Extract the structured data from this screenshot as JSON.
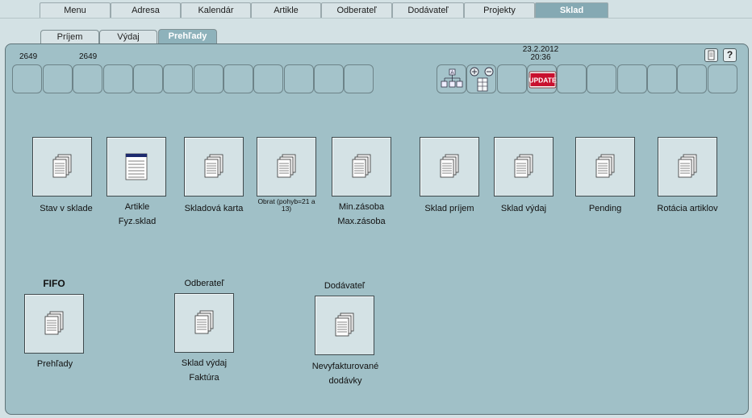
{
  "top_tabs": [
    {
      "label": "Menu"
    },
    {
      "label": "Adresa"
    },
    {
      "label": "Kalendár"
    },
    {
      "label": "Artikle"
    },
    {
      "label": "Odberateľ"
    },
    {
      "label": "Dodávateľ"
    },
    {
      "label": "Projekty"
    },
    {
      "label": "Sklad"
    }
  ],
  "sub_tabs": [
    {
      "label": "Príjem"
    },
    {
      "label": "Výdaj"
    },
    {
      "label": "Prehľady"
    }
  ],
  "header": {
    "code_left": "2649",
    "code_right": "2649",
    "date": "23.2.2012",
    "time": "20:36",
    "update_label": "UPDATE",
    "help_label": "?"
  },
  "tiles": [
    {
      "line1": "Stav v sklade",
      "line2": ""
    },
    {
      "line1": "Artikle",
      "line2": "Fyz.sklad"
    },
    {
      "line1": "Skladová karta",
      "line2": ""
    },
    {
      "line1": "Obrat (pohyb=21 a",
      "line2": "13)"
    },
    {
      "line1": "Min.zásoba",
      "line2": "Max.zásoba"
    },
    {
      "line1": "Sklad príjem",
      "line2": ""
    },
    {
      "line1": "Sklad výdaj",
      "line2": ""
    },
    {
      "line1": "Pending",
      "line2": ""
    },
    {
      "line1": "Rotácia artiklov",
      "line2": ""
    }
  ],
  "groups": [
    {
      "heading": "FIFO",
      "line1": "Prehľady",
      "line2": ""
    },
    {
      "heading": "Odberateľ",
      "line1": "Sklad výdaj",
      "line2": "Faktúra"
    },
    {
      "heading": "Dodávateľ",
      "line1": "Nevyfakturované",
      "line2": "dodávky"
    }
  ]
}
